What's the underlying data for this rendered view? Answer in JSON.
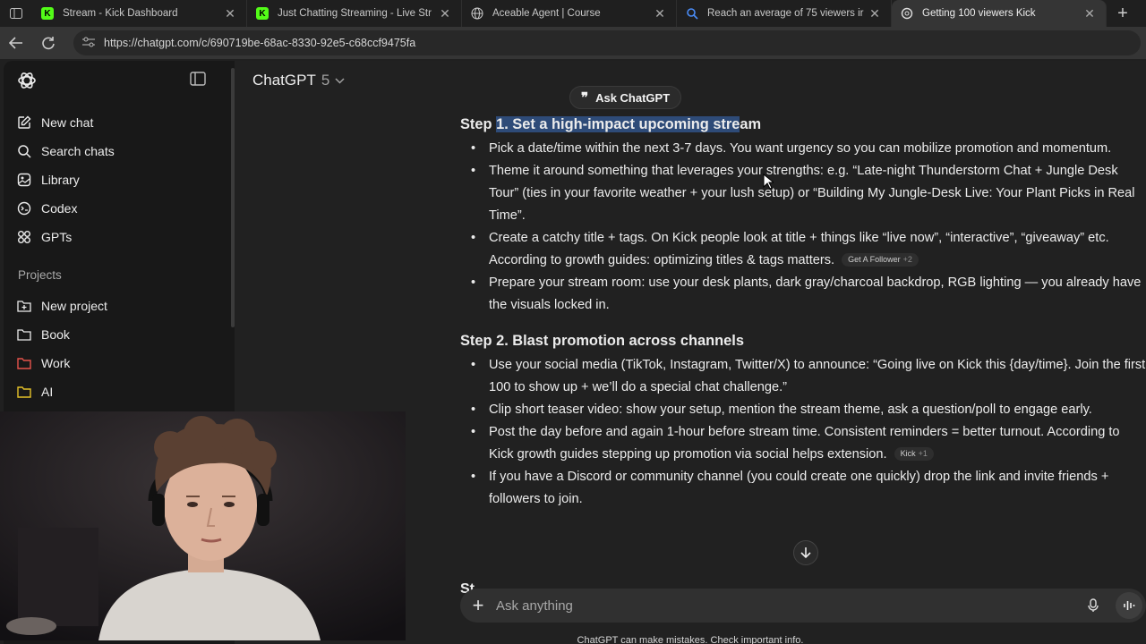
{
  "browser": {
    "tabs": [
      {
        "title": "Stream - Kick Dashboard",
        "favicon": "kick-icon",
        "color": "#53fc18"
      },
      {
        "title": "Just Chatting Streaming - Live Str",
        "favicon": "kick-icon",
        "color": "#53fc18"
      },
      {
        "title": "Aceable Agent | Course",
        "favicon": "globe-icon",
        "color": "#cccccc"
      },
      {
        "title": "Reach an average of 75 viewers ir",
        "favicon": "search-icon",
        "color": "#4a8cf7"
      },
      {
        "title": "Getting 100 viewers Kick",
        "favicon": "chatgpt-icon",
        "color": "#cccccc",
        "active": true
      }
    ],
    "url": "https://chatgpt.com/c/690719be-68ac-8330-92e5-c68ccf9475fa"
  },
  "sidebar": {
    "items": [
      {
        "label": "New chat",
        "icon": "edit-icon"
      },
      {
        "label": "Search chats",
        "icon": "search-icon"
      },
      {
        "label": "Library",
        "icon": "library-icon"
      },
      {
        "label": "Codex",
        "icon": "codex-icon"
      },
      {
        "label": "GPTs",
        "icon": "grid-icon"
      }
    ],
    "projects_label": "Projects",
    "projects": [
      {
        "label": "New project",
        "icon": "new-folder-icon",
        "color": "#ececec"
      },
      {
        "label": "Book",
        "icon": "folder-icon",
        "color": "#ececec"
      },
      {
        "label": "Work",
        "icon": "folder-icon",
        "color": "#e5534b"
      },
      {
        "label": "AI",
        "icon": "folder-icon",
        "color": "#e6c229"
      }
    ]
  },
  "header": {
    "model": "ChatGPT",
    "version": "5"
  },
  "ask_chatgpt_label": "Ask ChatGPT",
  "steps": {
    "step1": {
      "prefix": "Step ",
      "highlighted": "1. Set a high-impact upcoming stre",
      "suffix": "am",
      "bullets": [
        "Pick a date/time within the next 3-7 days. You want urgency so you can mobilize promotion and momentum.",
        "Theme it around something that leverages your strengths: e.g. “Late-night Thunderstorm Chat + Jungle Desk Tour” (ties in your favorite weather + your lush setup) or “Building My Jungle-Desk Live: Your Plant Picks in Real Time”.",
        "Create a catchy title + tags. On Kick people look at title + things like “live now”, “interactive”, “giveaway” etc. According to growth guides: optimizing titles & tags matters.",
        "Prepare your stream room: use your desk plants, dark gray/charcoal backdrop, RGB lighting — you already have the visuals locked in."
      ],
      "chip": {
        "label": "Get A Follower",
        "more": "+2"
      }
    },
    "step2": {
      "title": "Step 2. Blast promotion across channels",
      "bullets": [
        "Use your social media (TikTok, Instagram, Twitter/X) to announce: “Going live on Kick this {day/time}. Join the first 100 to show up + we’ll do a special chat challenge.”",
        "Clip short teaser video: show your setup, mention the stream theme, ask a question/poll to engage early.",
        "Post the day before and again 1-hour before stream time. Consistent reminders = better turnout. According to Kick growth guides stepping up promotion via social helps extension.",
        "If you have a Discord or community channel (you could create one quickly) drop the link and invite friends + followers to join."
      ],
      "chip": {
        "label": "Kick",
        "more": "+1"
      }
    },
    "next_heading_partial": "St"
  },
  "composer": {
    "placeholder": "Ask anything"
  },
  "disclaimer": "ChatGPT can make mistakes. Check important info."
}
